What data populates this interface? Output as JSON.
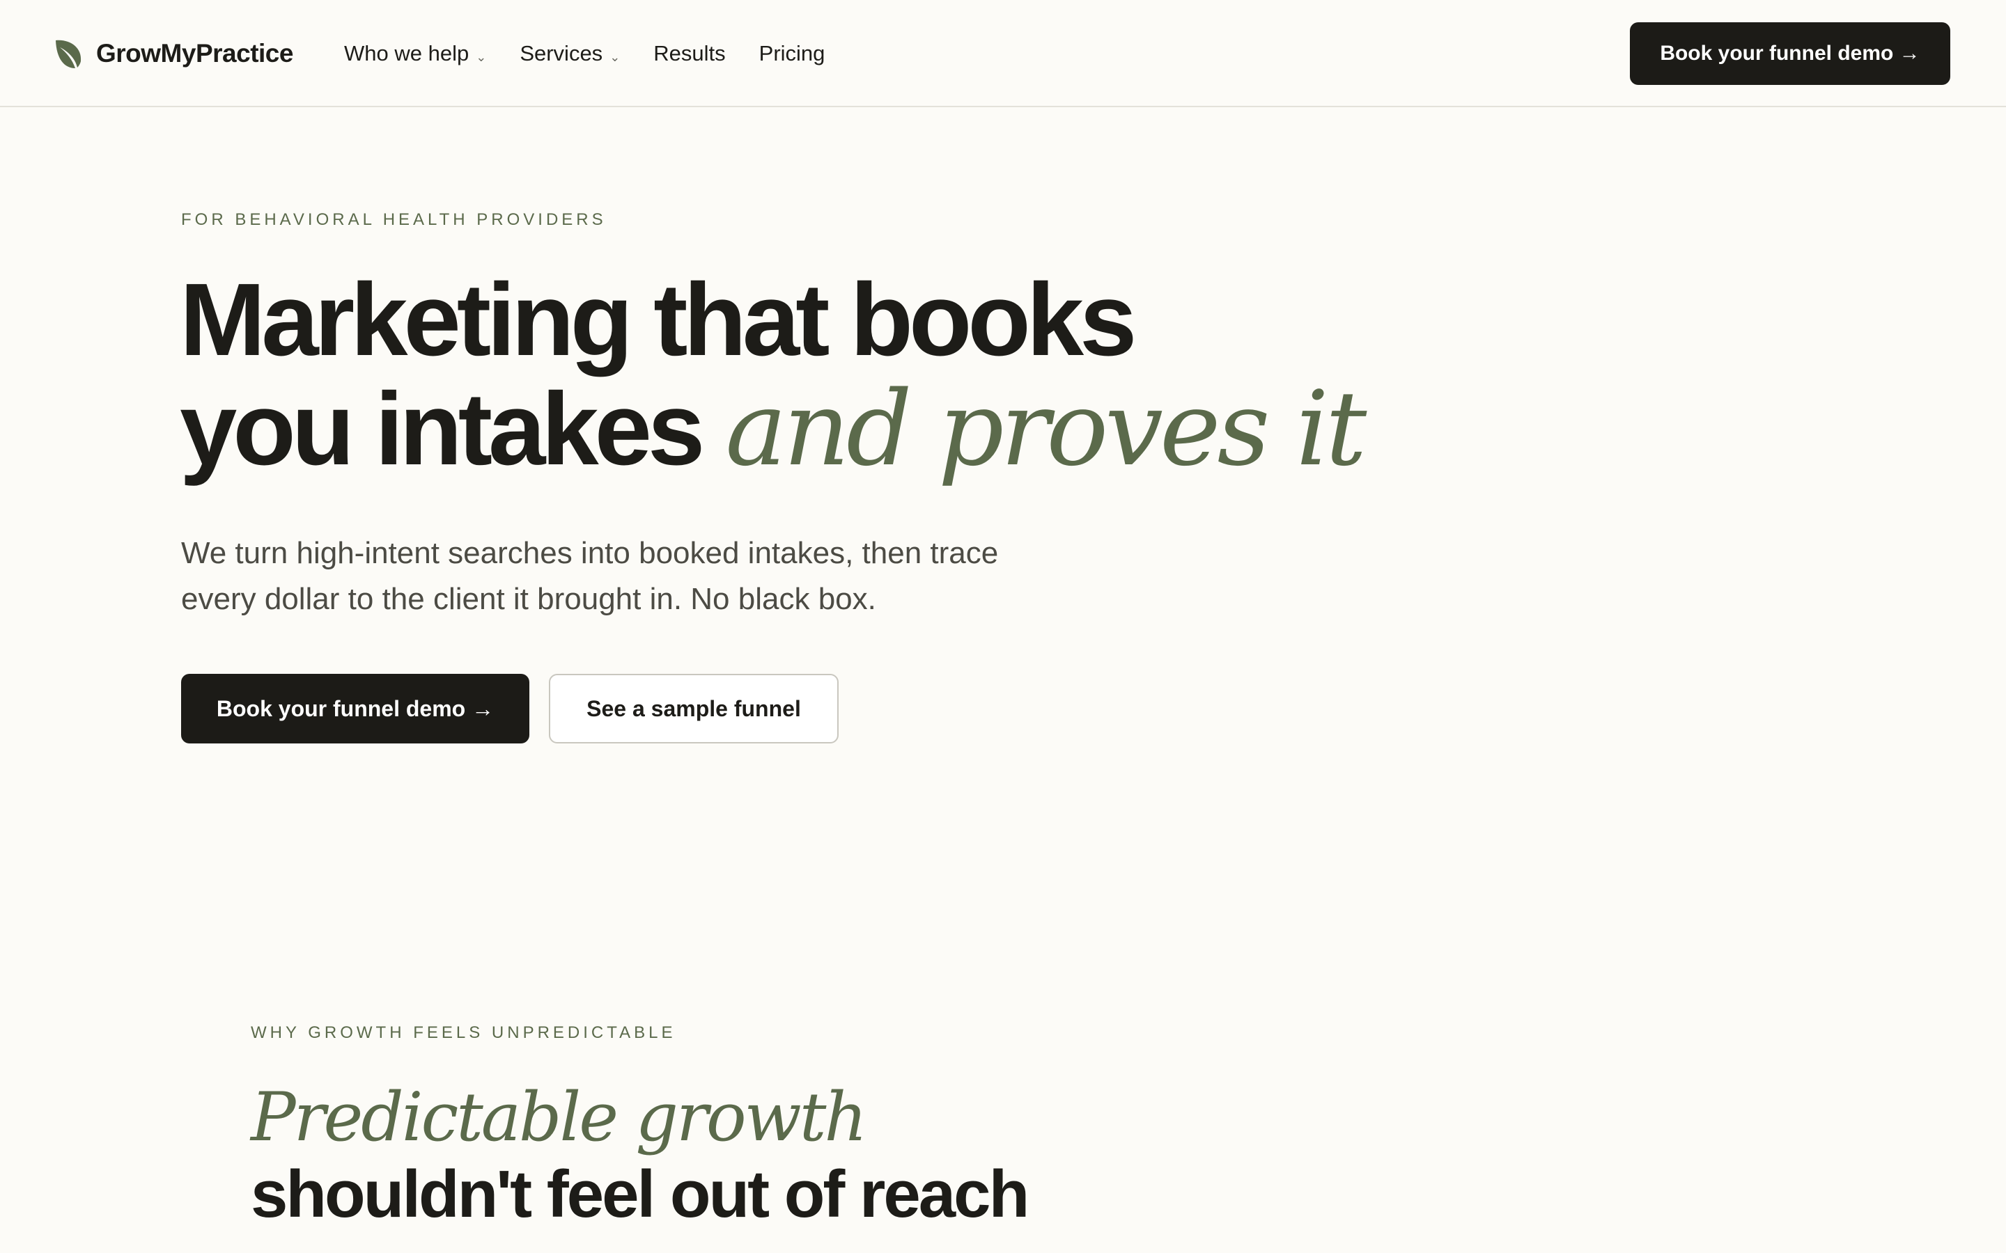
{
  "nav": {
    "brand": "GrowMyPractice",
    "brand_icon": "leaf-icon",
    "links": [
      {
        "label": "Who we help",
        "has_dropdown": true
      },
      {
        "label": "Services",
        "has_dropdown": true
      },
      {
        "label": "Results",
        "has_dropdown": false
      },
      {
        "label": "Pricing",
        "has_dropdown": false
      }
    ],
    "dropdown_icon": "chevron-down-icon",
    "cta_label": "Book your funnel demo →"
  },
  "hero": {
    "eyebrow": "FOR BEHAVIORAL HEALTH PROVIDERS",
    "title_line1": "Marketing that books",
    "title_line2_plain": "you intakes",
    "title_line2_accent": "and proves it",
    "subtitle": "We turn high-intent searches into booked intakes, then trace every dollar to the client it brought in. No black box.",
    "primary_cta": "Book your funnel demo →",
    "secondary_cta": "See a sample funnel"
  },
  "section_problem": {
    "eyebrow": "WHY GROWTH FEELS UNPREDICTABLE",
    "title_accent": "Predictable growth",
    "title_plain": "shouldn't feel out of reach"
  },
  "colors": {
    "background": "#fcfbf7",
    "text": "#1d1c18",
    "accent_green": "#5b6a4b",
    "button_dark": "#1c1b17"
  }
}
